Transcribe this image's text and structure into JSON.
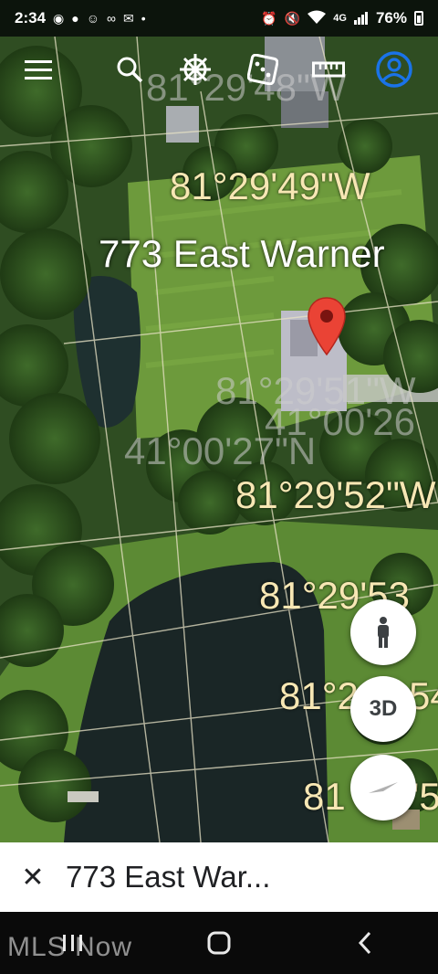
{
  "status": {
    "time": "2:34",
    "battery": "76%",
    "network": "4G"
  },
  "map": {
    "place": "773 East Warner",
    "coords": [
      "81°29'49\"W",
      "81°29'52\"W",
      "81°29'53",
      "81°2",
      "54",
      "81",
      "9'5"
    ],
    "ghost_coords": [
      "81°29'48\"W",
      "81°29'51\"W",
      "41°00'26",
      "41°00'27\"N"
    ]
  },
  "toolbar": {
    "icons": [
      "menu-icon",
      "search-icon",
      "voyager-wheel-icon",
      "dice-icon",
      "ruler-icon",
      "account-icon"
    ]
  },
  "fabs": {
    "threed_label": "3D"
  },
  "sheet": {
    "title": "773 East War..."
  },
  "watermark": "MLS Now",
  "colors": {
    "coord_text": "#f7e7b4",
    "pin": "#ea4335",
    "account": "#1a73e8"
  }
}
